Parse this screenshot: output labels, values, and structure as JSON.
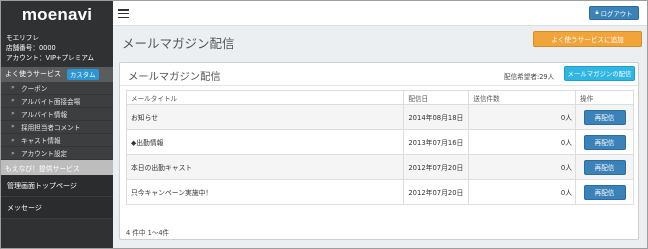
{
  "sidebar": {
    "logo": "moenavi",
    "user": {
      "name": "モエリフレ",
      "store": "店舗番号：0000",
      "account": "アカウント：VIP+プレミアム"
    },
    "section1": {
      "label": "よく使うサービス",
      "badge": "カスタム"
    },
    "items": [
      {
        "label": "クーポン"
      },
      {
        "label": "アルバイト面接会場"
      },
      {
        "label": "アルバイト情報"
      },
      {
        "label": "採用担当者コメント"
      },
      {
        "label": "キャスト情報"
      },
      {
        "label": "アカウント設定"
      }
    ],
    "section2": {
      "label": "もえなび！提供サービス"
    },
    "links": [
      {
        "label": "管理画面トップページ"
      },
      {
        "label": "メッセージ"
      }
    ]
  },
  "topbar": {
    "logout_label": "ログアウト",
    "logout_icon": "lock-icon",
    "menu_icon": "hamburger-icon"
  },
  "header": {
    "title": "メールマガジン配信",
    "fav_button": "よく使うサービスに追加"
  },
  "panel": {
    "title": "メールマガジン配信",
    "subscribers": "配信希望者:29人",
    "button": "メールマガジンの配信",
    "columns": [
      "メールタイトル",
      "配信日",
      "送信件数",
      "操作"
    ],
    "rows": [
      {
        "title": "お知らせ",
        "date": "2014年08月18日",
        "count": "0人",
        "action": "再配信"
      },
      {
        "title": "◆出勤情報",
        "date": "2013年07月16日",
        "count": "0人",
        "action": "再配信"
      },
      {
        "title": "本日の出勤キャスト",
        "date": "2012年07月20日",
        "count": "0人",
        "action": "再配信"
      },
      {
        "title": "只今キャンペーン実施中！",
        "date": "2012年07月20日",
        "count": "0人",
        "action": "再配信"
      }
    ],
    "pager": "4 件中 1～4件"
  },
  "colors": {
    "sidebar_bg": "#2f3133",
    "primary_button": "#3b82b8",
    "orange_button": "#f0a43a",
    "cyan_button": "#2fb6e3"
  }
}
